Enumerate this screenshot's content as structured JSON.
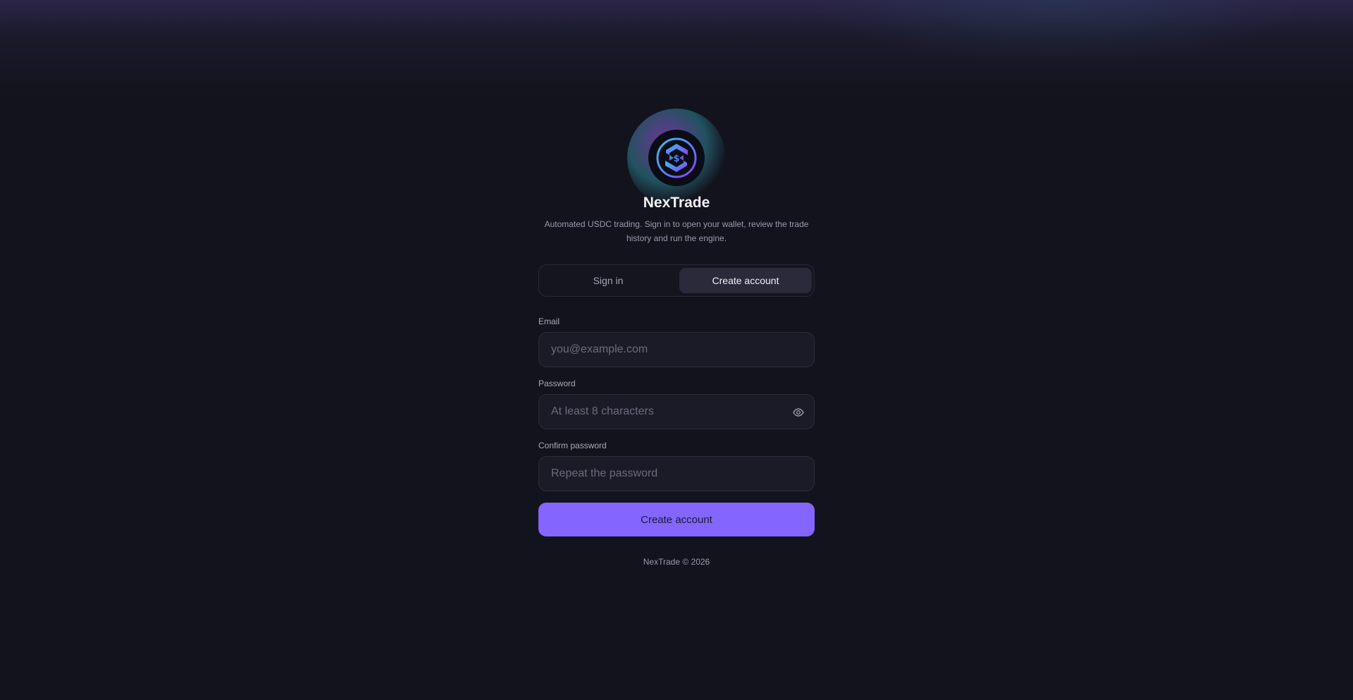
{
  "brand": {
    "name": "NexTrade",
    "tagline": "Automated USDC trading. Sign in to open your wallet, review the trade history and run the engine.",
    "logo_icon": "usdc-coin-icon"
  },
  "tabs": {
    "signin_label": "Sign in",
    "create_label": "Create account",
    "active": "create"
  },
  "form": {
    "email": {
      "label": "Email",
      "placeholder": "you@example.com",
      "value": ""
    },
    "password": {
      "label": "Password",
      "placeholder": "At least 8 characters",
      "value": "",
      "toggle_icon": "eye-icon"
    },
    "confirm": {
      "label": "Confirm password",
      "placeholder": "Repeat the password",
      "value": ""
    },
    "submit_label": "Create account"
  },
  "footer": {
    "text": "NexTrade © 2026"
  },
  "colors": {
    "background": "#13131d",
    "accent": "#8466ff",
    "field_bg": "#1b1b27",
    "border": "#2d2d3b"
  }
}
